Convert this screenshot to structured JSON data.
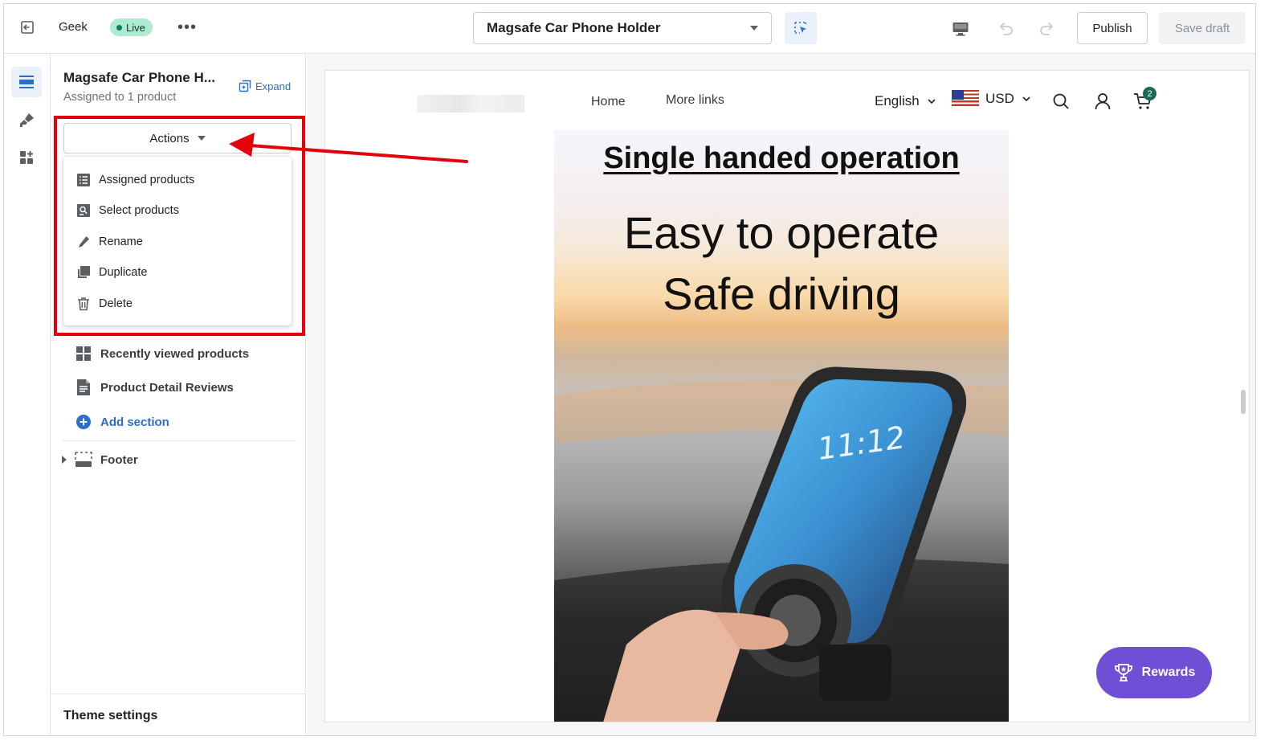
{
  "topbar": {
    "store_name": "Geek",
    "live_label": "Live",
    "more_label": "•••",
    "template_name": "Magsafe Car Phone Holder",
    "publish_label": "Publish",
    "save_draft_label": "Save draft"
  },
  "sidebar": {
    "title": "Magsafe Car Phone H...",
    "subtitle": "Assigned to 1 product",
    "expand_label": "Expand",
    "actions_label": "Actions",
    "actions_menu": [
      {
        "label": "Assigned products",
        "icon": "list-icon"
      },
      {
        "label": "Select products",
        "icon": "search-list-icon"
      },
      {
        "label": "Rename",
        "icon": "pencil-icon"
      },
      {
        "label": "Duplicate",
        "icon": "duplicate-icon"
      },
      {
        "label": "Delete",
        "icon": "trash-icon"
      }
    ],
    "sections": [
      {
        "label": "Recently viewed products",
        "icon": "grid-icon"
      },
      {
        "label": "Product Detail Reviews",
        "icon": "document-icon"
      }
    ],
    "add_section_label": "Add section",
    "footer_label": "Footer",
    "theme_settings_label": "Theme settings"
  },
  "preview": {
    "nav": [
      "Home",
      "More links"
    ],
    "language": "English",
    "currency": "USD",
    "cart_count": "2",
    "banner": {
      "headline": "Single handed operation",
      "line1": "Easy to operate",
      "line2": "Safe driving",
      "phone_time": "11:12"
    },
    "rewards_label": "Rewards"
  },
  "colors": {
    "accent": "#2c6ecb",
    "live_badge": "#aee9d1",
    "highlight": "#e3000b",
    "rewards": "#6f4fd6",
    "cart_badge": "#1a6a5a"
  }
}
